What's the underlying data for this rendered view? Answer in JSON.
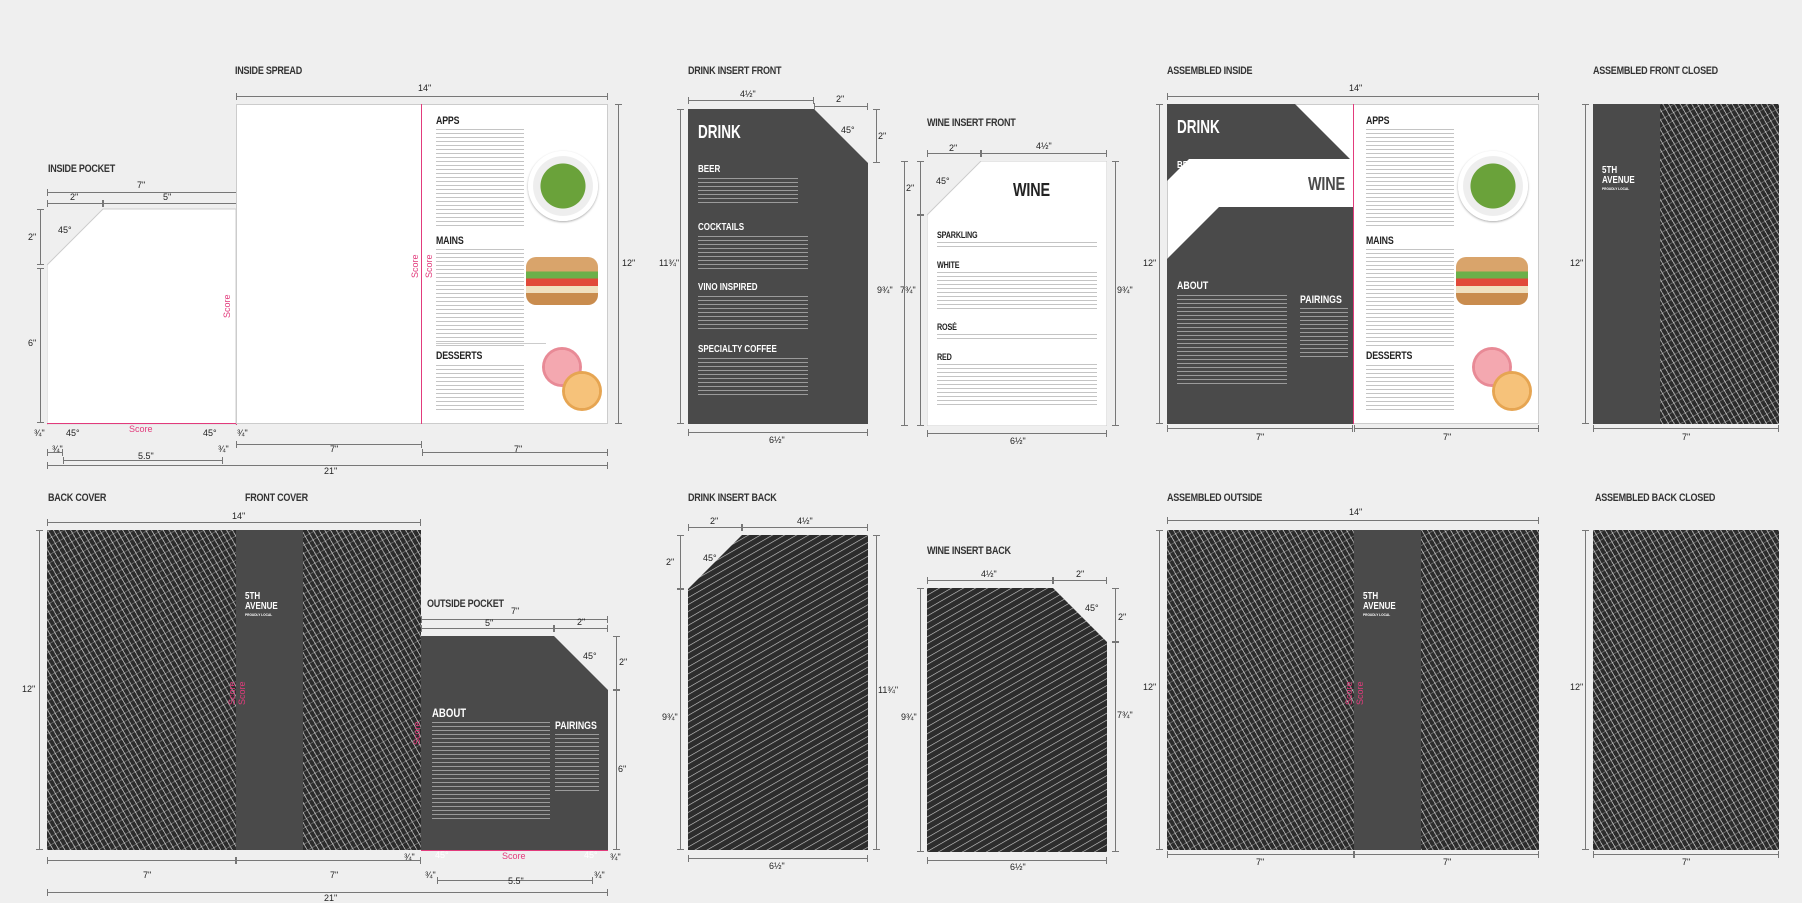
{
  "sections": {
    "inside_pocket": "INSIDE POCKET",
    "inside_spread": "INSIDE SPREAD",
    "drink_insert_front": "DRINK INSERT FRONT",
    "wine_insert_front": "WINE INSERT FRONT",
    "assembled_inside": "ASSEMBLED INSIDE",
    "assembled_front_closed": "ASSEMBLED FRONT CLOSED",
    "back_cover": "BACK COVER",
    "front_cover": "FRONT COVER",
    "outside_pocket": "OUTSIDE POCKET",
    "drink_insert_back": "DRINK INSERT BACK",
    "wine_insert_back": "WINE INSERT BACK",
    "assembled_outside": "ASSEMBLED OUTSIDE",
    "assembled_back_closed": "ASSEMBLED BACK CLOSED"
  },
  "dims": {
    "d14": "14\"",
    "d12": "12\"",
    "d7": "7\"",
    "d5": "5\"",
    "d2": "2\"",
    "d6": "6\"",
    "d21": "21\"",
    "d55": "5.5\"",
    "d34": "¾\"",
    "a45": "45°",
    "d4_12": "4½\"",
    "d6_12": "6½\"",
    "d11_34": "11¾\"",
    "d9_34": "9¾\"",
    "d7_34": "7¾\""
  },
  "score": "Score",
  "brand": {
    "line1": "5TH",
    "line2": "AVENUE",
    "tag": "PROUDLY LOCAL"
  },
  "menu": {
    "apps": "APPS",
    "mains": "MAINS",
    "desserts": "DESSERTS",
    "about": "ABOUT",
    "pairings": "PAIRINGS"
  },
  "drink": {
    "title": "DRINK",
    "beer": "BEER",
    "cocktails": "COCKTAILS",
    "vino": "VINO INSPIRED",
    "coffee": "SPECIALTY COFFEE"
  },
  "wine": {
    "title": "WINE",
    "sparkling": "SPARKLING",
    "white": "WHITE",
    "rose": "ROSÉ",
    "red": "RED"
  }
}
